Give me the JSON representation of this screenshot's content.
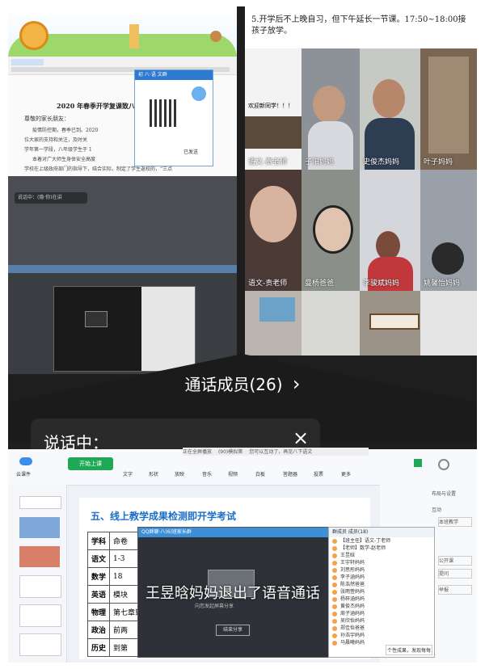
{
  "top_note": "5.开学后不上晚自习，但下午延长一节课。17:50~18:00接孩子放学。",
  "doc": {
    "title": "2020 年春季开学复课致八",
    "greeting": "尊敬的家长朋友：",
    "lines": [
      "疫情防控期，春季已到。2020",
      "位大家的支持和关注，及时关",
      "学年第一学段，八年级学生于 1",
      "本着对广大师生身体安全高度",
      "学校在上级政府部门的指导下，结合实际，制定了学生返校的，“三点"
    ],
    "chat_header": "初 八·语 文群",
    "status": "已发送",
    "gray_text": "说话中：(隐·你)在讲"
  },
  "grid": {
    "welcome": "欢迎新同学！！！",
    "tiles": [
      {
        "label": "语文-责老师"
      },
      {
        "label": "子阳妈妈"
      },
      {
        "label": "史俊杰妈妈"
      },
      {
        "label": "叶子妈妈"
      },
      {
        "label": "语文-责老师"
      },
      {
        "label": "曼杨爸爸"
      },
      {
        "label": "李骏斌妈妈"
      },
      {
        "label": "姚馨怡妈妈"
      },
      {
        "label": ""
      },
      {
        "label": ""
      },
      {
        "label": ""
      },
      {
        "label": ""
      }
    ]
  },
  "call": {
    "members": "通话成员(26)",
    "speaking": "说话中：",
    "close": "×",
    "chevron": "›"
  },
  "ppt": {
    "top_tabs": [
      "正在全屏播放",
      "(90)模拟第",
      "您可以互动了，再见八下语文"
    ],
    "toolbar": [
      "云课件",
      "开始上课",
      "文字",
      "形状",
      "放映",
      "音乐",
      "视频",
      "白板",
      "答题器",
      "投票",
      "更多"
    ],
    "right_panel": [
      "布局与设置",
      "互动",
      "本班教学",
      "公开课",
      "提问",
      "举报"
    ],
    "heading": "五、线上教学成果检测即开学考试",
    "rows": [
      {
        "subject": "学科",
        "content": "命卷"
      },
      {
        "subject": "语文",
        "content": "1-3"
      },
      {
        "subject": "数学",
        "content": "18"
      },
      {
        "subject": "英语",
        "content": "模块"
      },
      {
        "subject": "物理",
        "content": "第七章到"
      },
      {
        "subject": "政治",
        "content": "前两"
      },
      {
        "subject": "历史",
        "content": "到第"
      }
    ],
    "video_title": "QQ群聊·八(6)班家长群",
    "video_button": "结束分享",
    "video_caption": "向您发起屏幕分享",
    "toast": "王昱晗妈妈退出了语音通话",
    "member_header": "群成员 成员(18)",
    "members": [
      "【班主任】语文-丁老师",
      "【老师】数学-赵老师",
      "王昱晗",
      "王宇轩妈妈",
      "刘思彤妈妈",
      "李子涵妈妈",
      "陈浩然爸爸",
      "张雨萱妈妈",
      "杨梓涵妈妈",
      "黄俊杰妈妈",
      "周子涵妈妈",
      "吴欣怡妈妈",
      "郑佳怡爸爸",
      "孙浩宇妈妈",
      "马晨曦妈妈"
    ],
    "notice": "个性成果，发现每每"
  }
}
